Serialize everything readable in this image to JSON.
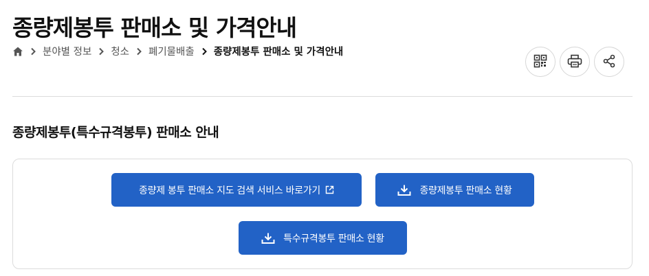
{
  "page": {
    "title": "종량제봉투 판매소 및 가격안내"
  },
  "breadcrumb": {
    "home_icon": "home-icon",
    "items": [
      {
        "label": "분야별 정보"
      },
      {
        "label": "청소"
      },
      {
        "label": "폐기물배출"
      },
      {
        "label": "종량제봉투 판매소 및 가격안내"
      }
    ]
  },
  "tools": {
    "qr_icon": "qr-code-icon",
    "print_icon": "printer-icon",
    "share_icon": "share-icon"
  },
  "section": {
    "title": "종량제봉투(특수규격봉투) 판매소 안내"
  },
  "buttons": {
    "map_service": "종량제 봉투 판매소 지도 검색 서비스 바로가기",
    "status_download": "종량제봉투 판매소 현황",
    "special_download": "특수규격봉투 판매소 현황"
  },
  "colors": {
    "accent": "#2262c6",
    "border": "#dcdcdc"
  }
}
